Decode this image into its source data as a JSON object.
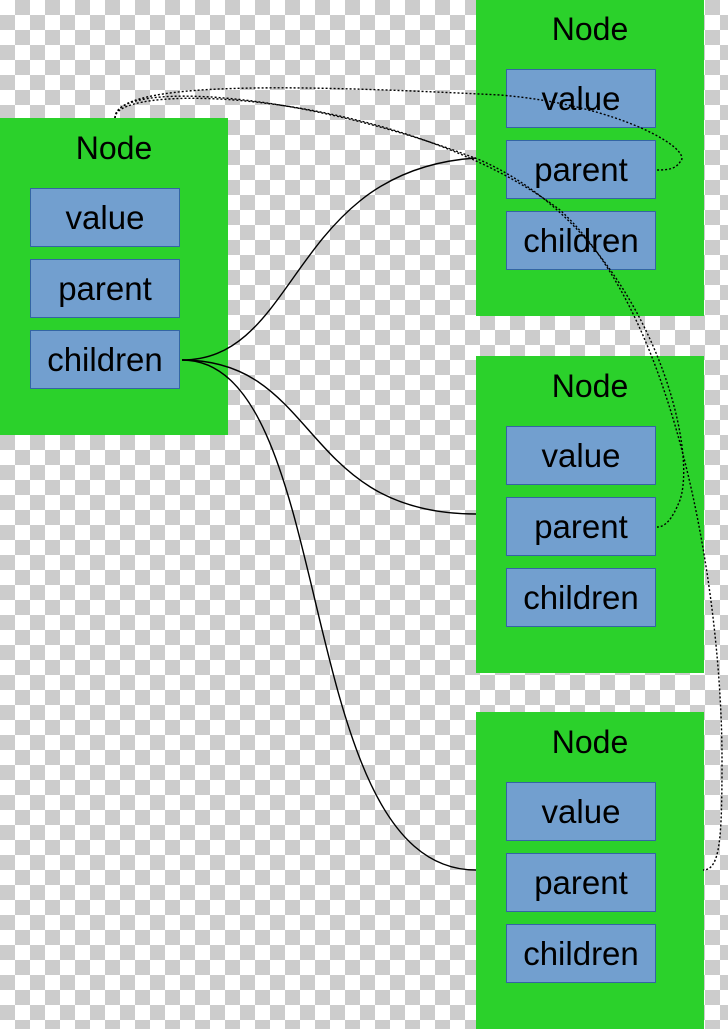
{
  "colors": {
    "node": "#2bd12b",
    "field": "#729fcf",
    "field_border": "#3465a4",
    "edge": "#000000"
  },
  "nodes": [
    {
      "title": "Node",
      "fields": [
        "value",
        "parent",
        "children"
      ]
    },
    {
      "title": "Node",
      "fields": [
        "value",
        "parent",
        "children"
      ]
    },
    {
      "title": "Node",
      "fields": [
        "value",
        "parent",
        "children"
      ]
    },
    {
      "title": "Node",
      "fields": [
        "value",
        "parent",
        "children"
      ]
    }
  ],
  "edges": {
    "children_links": [
      "root.children -> node1",
      "root.children -> node2",
      "root.children -> node3"
    ],
    "parent_links": [
      "node1.parent -> root",
      "node2.parent -> root",
      "node3.parent -> root"
    ]
  }
}
